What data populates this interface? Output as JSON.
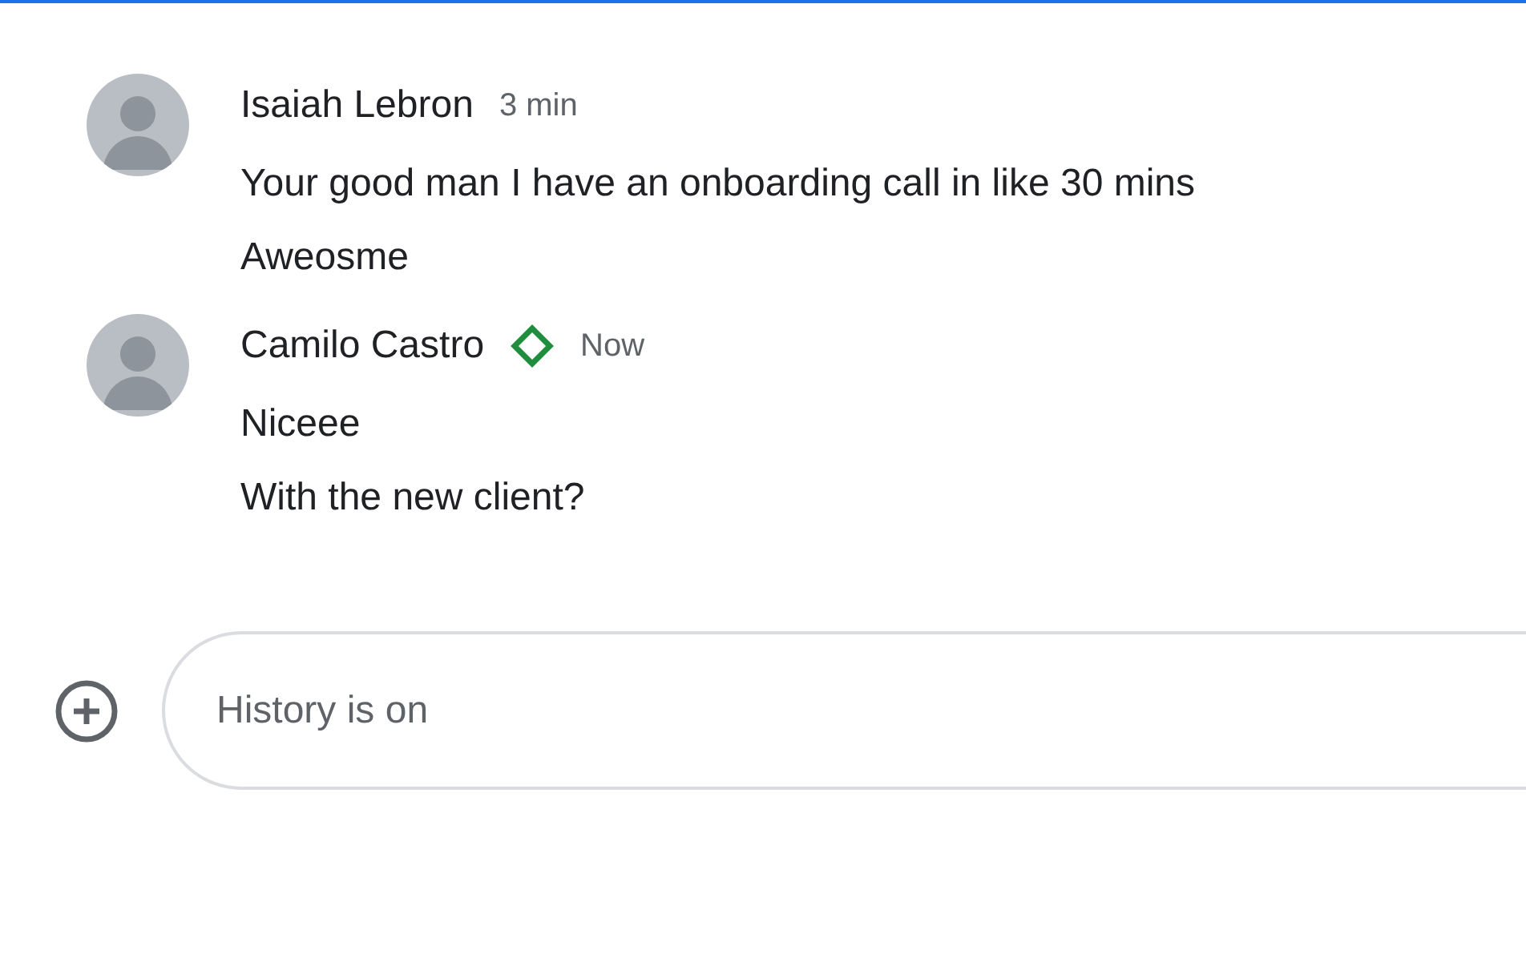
{
  "messages": [
    {
      "sender": "Isaiah Lebron",
      "badge": false,
      "time": "3 min",
      "lines": [
        "Your good man I have an onboarding call in like 30 mins",
        "Aweosme"
      ]
    },
    {
      "sender": "Camilo Castro",
      "badge": true,
      "time": "Now",
      "lines": [
        "Niceee",
        "With the new client?"
      ]
    }
  ],
  "composer": {
    "placeholder": "History is on"
  }
}
